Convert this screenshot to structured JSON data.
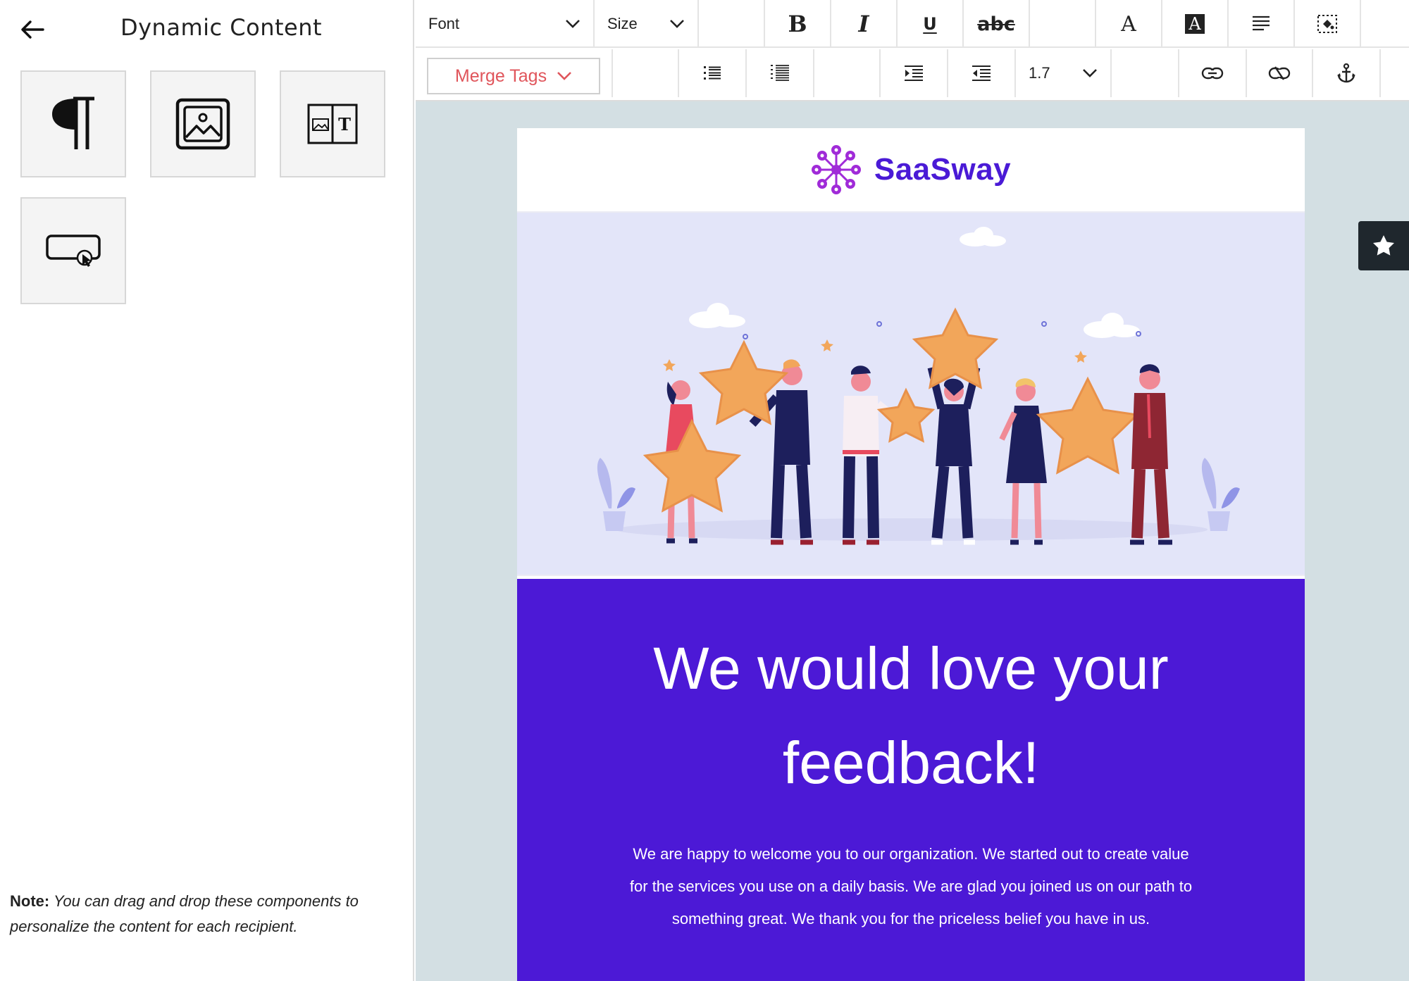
{
  "left_panel": {
    "title": "Dynamic Content",
    "components": [
      {
        "name": "text",
        "icon": "pilcrow-icon"
      },
      {
        "name": "image",
        "icon": "image-icon"
      },
      {
        "name": "image-text",
        "icon": "image-text-icon"
      },
      {
        "name": "button",
        "icon": "button-click-icon"
      }
    ],
    "note_label": "Note:",
    "note_text": "You can drag and drop these components to personalize the content for each recipient."
  },
  "toolbar": {
    "font_label": "Font",
    "size_label": "Size",
    "merge_tags_label": "Merge Tags",
    "line_height_value": "1.7",
    "strike_label": "abc",
    "buttons_row1": [
      "bold-icon",
      "italic-icon",
      "underline-icon",
      "strikethrough-icon",
      "font-color-icon",
      "background-color-icon",
      "align-icon",
      "fill-icon"
    ],
    "buttons_row2": [
      "unordered-list-icon",
      "ordered-list-icon",
      "indent-icon",
      "outdent-icon",
      "link-icon",
      "unlink-icon",
      "anchor-icon"
    ]
  },
  "email": {
    "brand_name": "SaaSway",
    "headline_line1": "We would love your",
    "headline_line2": "feedback!",
    "body": "We are happy to welcome you to our organization. We started out to create value for the services you use on a daily basis. We are glad you joined us on our path to something great. We thank you for the priceless belief you have in us."
  },
  "colors": {
    "brand": "#4a1ad6",
    "feedback_bg": "#4c19d6",
    "hero_bg": "#e3e5f9",
    "merge_tags": "#e0555b",
    "canvas_bg": "#d3dfe3",
    "logo": "#a02bd8"
  }
}
